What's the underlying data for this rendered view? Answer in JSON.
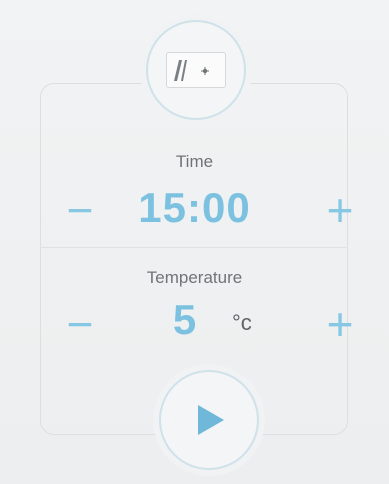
{
  "time": {
    "label": "Time",
    "value": "15:00",
    "decrease_label": "−",
    "increase_label": "+"
  },
  "temperature": {
    "label": "Temperature",
    "value": "5",
    "unit": "°c",
    "decrease_label": "−",
    "increase_label": "+"
  },
  "icons": {
    "program": "program-icon",
    "start": "play-icon"
  },
  "colors": {
    "accent": "#7cc2e0",
    "text": "#6f7477",
    "background": "#eef1f2"
  }
}
